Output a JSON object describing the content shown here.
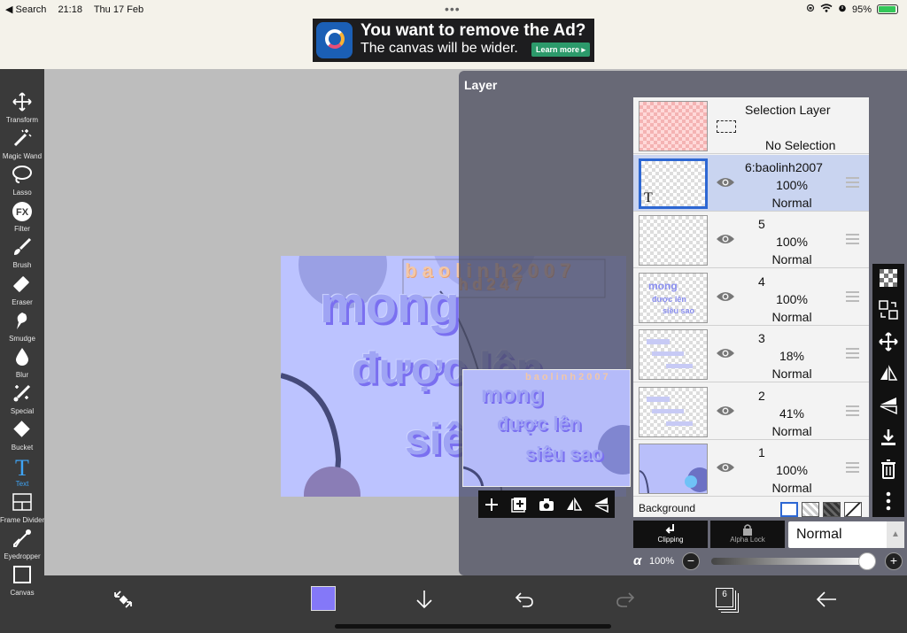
{
  "status": {
    "back_label": "◀ Search",
    "time": "21:18",
    "date": "Thu 17 Feb",
    "battery": "95%",
    "battery_level": 0.95
  },
  "ad": {
    "headline": "You want to remove the Ad?",
    "subline": "The canvas will be wider.",
    "button": "Learn more ▸"
  },
  "tools": [
    {
      "name": "transform",
      "label": "Transform",
      "icon": "move-arrows-icon"
    },
    {
      "name": "magic-wand",
      "label": "Magic Wand",
      "icon": "magic-wand-icon"
    },
    {
      "name": "lasso",
      "label": "Lasso",
      "icon": "lasso-icon"
    },
    {
      "name": "filter",
      "label": "Filter",
      "icon": "fx-icon"
    },
    {
      "name": "brush",
      "label": "Brush",
      "icon": "brush-icon"
    },
    {
      "name": "eraser",
      "label": "Eraser",
      "icon": "eraser-icon"
    },
    {
      "name": "smudge",
      "label": "Smudge",
      "icon": "smudge-icon"
    },
    {
      "name": "blur",
      "label": "Blur",
      "icon": "drop-icon"
    },
    {
      "name": "special",
      "label": "Special",
      "icon": "special-brush-icon"
    },
    {
      "name": "bucket",
      "label": "Bucket",
      "icon": "bucket-icon"
    },
    {
      "name": "text",
      "label": "Text",
      "icon": "text-icon",
      "active": true
    },
    {
      "name": "frame-divider",
      "label": "Frame Divider",
      "icon": "frame-divider-icon"
    },
    {
      "name": "eyedropper",
      "label": "Eyedropper",
      "icon": "eyedropper-icon"
    },
    {
      "name": "canvas",
      "label": "Canvas",
      "icon": "canvas-icon"
    }
  ],
  "artwork": {
    "signature": "baolinh2007",
    "signature_2": "hd247",
    "line1": "mong",
    "line2": "được lên",
    "line3": "siêu sao",
    "bg_color": "#bcc3ff"
  },
  "layer_panel": {
    "title": "Layer",
    "selection_layer": {
      "name": "Selection Layer",
      "status": "No Selection"
    },
    "layers": [
      {
        "name": "6:baolinh2007",
        "opacity": "100%",
        "blend": "Normal",
        "selected": true,
        "kind": "text"
      },
      {
        "name": "5",
        "opacity": "100%",
        "blend": "Normal",
        "selected": false,
        "kind": "empty"
      },
      {
        "name": "4",
        "opacity": "100%",
        "blend": "Normal",
        "selected": false,
        "kind": "lettering"
      },
      {
        "name": "3",
        "opacity": "18%",
        "blend": "Normal",
        "selected": false,
        "kind": "faint"
      },
      {
        "name": "2",
        "opacity": "41%",
        "blend": "Normal",
        "selected": false,
        "kind": "faint"
      },
      {
        "name": "1",
        "opacity": "100%",
        "blend": "Normal",
        "selected": false,
        "kind": "fill"
      }
    ],
    "background_label": "Background",
    "clipping_label": "Clipping",
    "alpha_lock_label": "Alpha Lock",
    "blend_mode": "Normal",
    "alpha_symbol": "α",
    "alpha_value": "100%",
    "alpha_level": 1.0
  },
  "bottom_bar": {
    "layer_count": "6",
    "primary_color": "#8478f8"
  },
  "colors": {
    "accent_blue": "#2d67d3",
    "active_tool": "#3fa4f5",
    "toolbar_bg": "#3a3a3a"
  }
}
